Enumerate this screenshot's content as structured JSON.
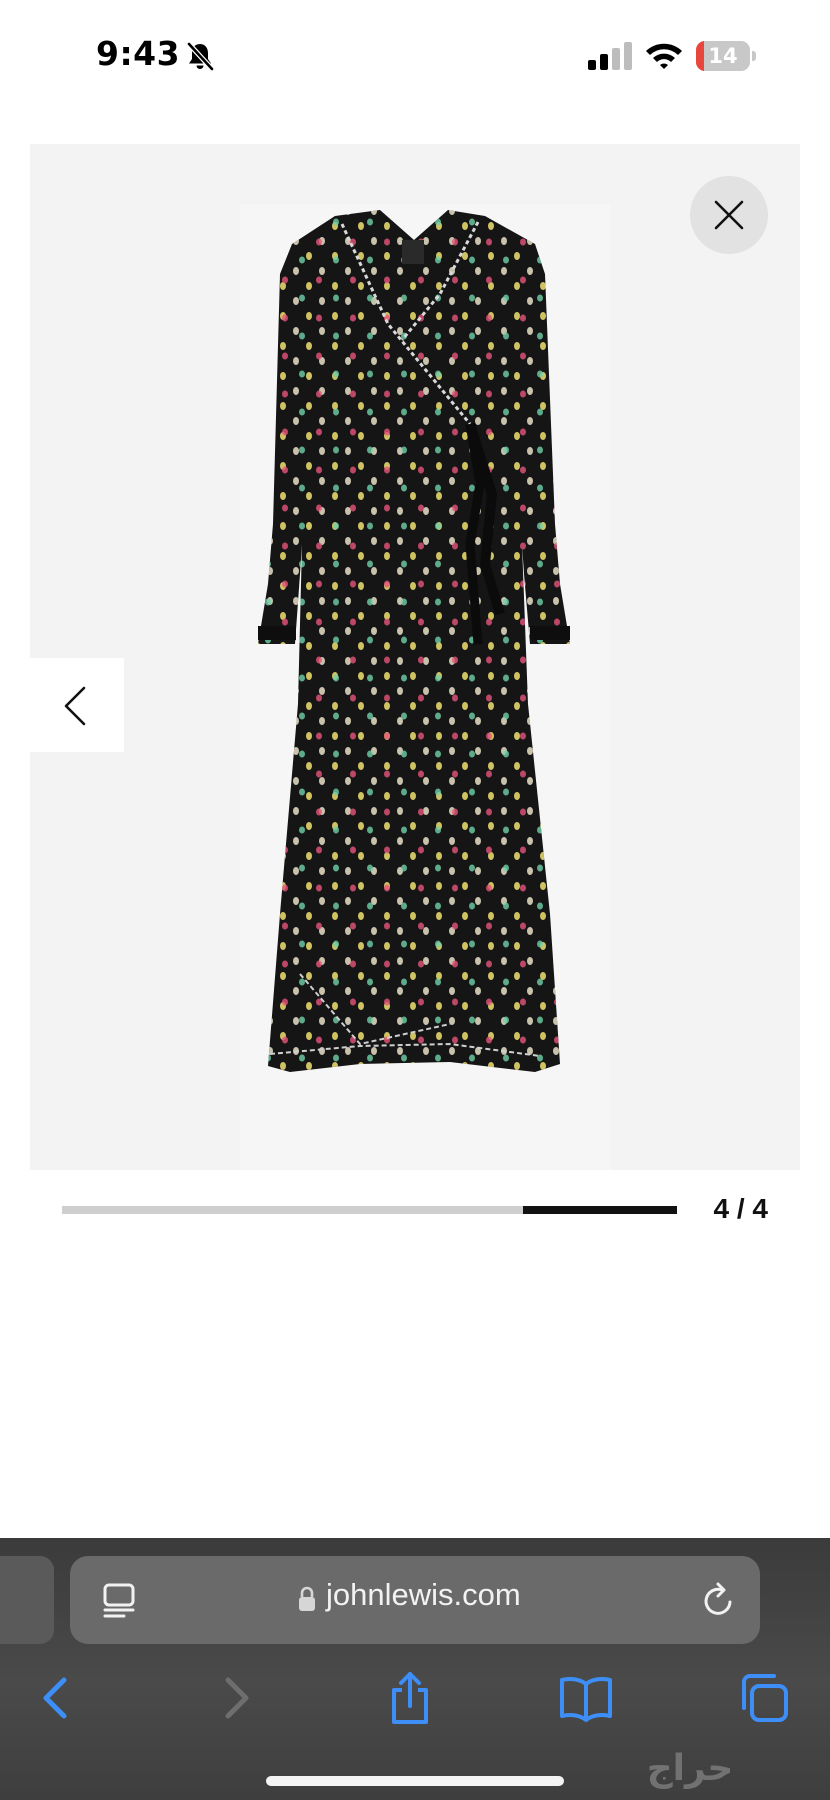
{
  "status_bar": {
    "time": "9:43",
    "battery_level": "14",
    "battery_fraction": 0.14,
    "icons": [
      "bell-slash-icon",
      "cellular-signal-icon",
      "wifi-icon",
      "battery-icon"
    ]
  },
  "gallery": {
    "page_counter": "4 / 4",
    "current_image": 4,
    "total_images": 4,
    "progress_fraction": 0.25,
    "progress_position": "last-segment",
    "colors": {
      "background": "#f3f3f3",
      "dress": "#151515",
      "progress_track": "#cfcfcf",
      "progress_fill": "#111111"
    },
    "icons": [
      "close-icon",
      "chevron-left-icon"
    ]
  },
  "browser": {
    "url": "johnlewis.com",
    "icons": [
      "reader-view-icon",
      "lock-icon",
      "reload-icon",
      "back-icon",
      "forward-icon",
      "share-icon",
      "bookmarks-icon",
      "tabs-icon"
    ],
    "colors": {
      "accent": "#3e8ef7",
      "toolbar": "#444444",
      "address_bar": "#6a6a6a"
    }
  },
  "watermark": {
    "text": "حراج"
  }
}
